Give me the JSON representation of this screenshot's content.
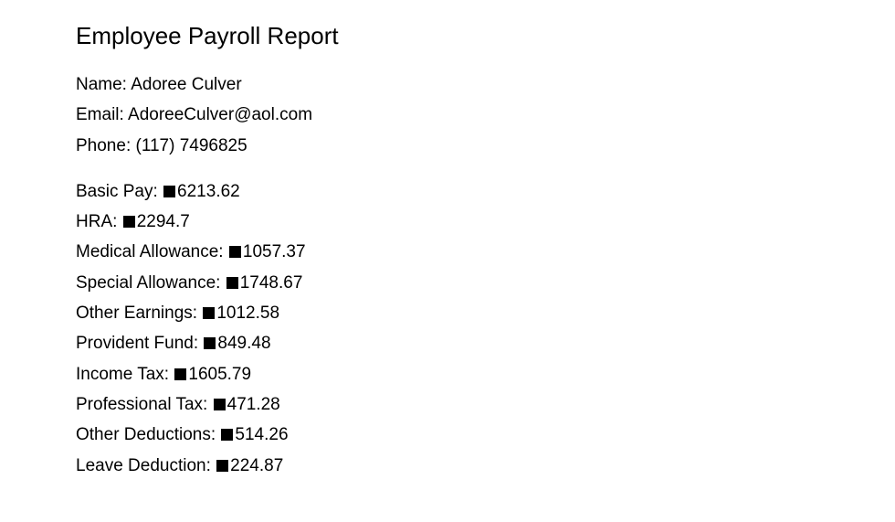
{
  "report": {
    "title": "Employee Payroll Report"
  },
  "employee": {
    "name_label": "Name: ",
    "name": "Adoree Culver",
    "email_label": "Email: ",
    "email": "AdoreeCulver@aol.com",
    "phone_label": "Phone: ",
    "phone": "(117) 7496825"
  },
  "currency_icon": "black-square-glyph",
  "pay_items": [
    {
      "label": "Basic Pay: ",
      "value": "6213.62"
    },
    {
      "label": "HRA: ",
      "value": "2294.7"
    },
    {
      "label": "Medical Allowance: ",
      "value": "1057.37"
    },
    {
      "label": "Special Allowance: ",
      "value": "1748.67"
    },
    {
      "label": "Other Earnings: ",
      "value": "1012.58"
    },
    {
      "label": "Provident Fund: ",
      "value": "849.48"
    },
    {
      "label": "Income Tax: ",
      "value": "1605.79"
    },
    {
      "label": "Professional Tax: ",
      "value": "471.28"
    },
    {
      "label": "Other Deductions: ",
      "value": "514.26"
    },
    {
      "label": "Leave Deduction: ",
      "value": "224.87"
    }
  ]
}
